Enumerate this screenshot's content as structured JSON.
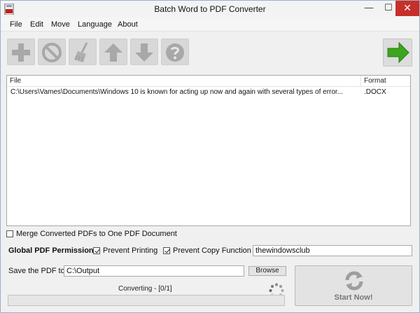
{
  "window": {
    "title": "Batch Word to PDF Converter"
  },
  "title_controls": {
    "minimize": "—",
    "maximize": "☐",
    "close": "✕"
  },
  "menu": {
    "items": [
      "File",
      "Edit",
      "Move",
      "Language",
      "About"
    ]
  },
  "toolbar": {
    "buttons": [
      "add-icon",
      "remove-icon",
      "clear-broom-icon",
      "move-up-icon",
      "move-down-icon",
      "help-icon"
    ],
    "go_button": "arrow-right-icon"
  },
  "filelist": {
    "columns": [
      "File",
      "Format"
    ],
    "rows": [
      {
        "file": "C:\\Users\\Vames\\Documents\\Windows 10 is known for acting up now and again with several types of error...",
        "format": ".DOCX"
      }
    ]
  },
  "options": {
    "merge": {
      "label": "Merge Converted PDFs to One PDF Document",
      "checked": false
    },
    "permission_label": "Global PDF Permission:",
    "prevent_printing": {
      "label": "Prevent Printing",
      "checked": true
    },
    "prevent_copy": {
      "label": "Prevent Copy Function",
      "checked": true
    },
    "password_value": "thewindowsclub"
  },
  "output": {
    "label": "Save the PDF to",
    "path": "C:\\Output",
    "browse_label": "Browse"
  },
  "status": {
    "text": "Converting - [0/1]",
    "progress": 0.0
  },
  "start": {
    "label": "Start Now!"
  },
  "colors": {
    "green": "#3aa51d",
    "close_red": "#c7302a",
    "tool_gray": "#d8d8d8"
  }
}
